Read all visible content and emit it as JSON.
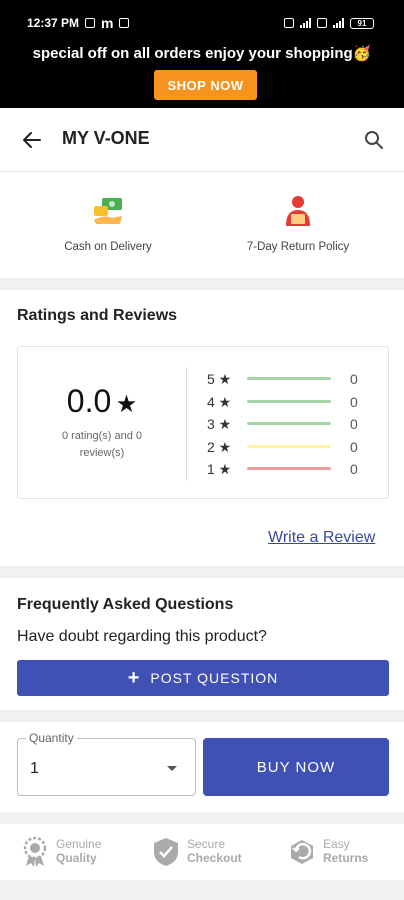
{
  "status_bar": {
    "time": "12:37 PM",
    "battery": "91"
  },
  "promo": {
    "text": "special off on all orders enjoy your shopping🥳",
    "button_label": "SHOP NOW",
    "button_color": "#f7941d"
  },
  "app_bar": {
    "title": "MY V-ONE",
    "back_icon": "arrow-left-icon",
    "search_icon": "search-icon"
  },
  "policies": [
    {
      "label": "Cash on Delivery",
      "icon": "cash-hand-icon"
    },
    {
      "label": "7-Day Return Policy",
      "icon": "return-person-icon"
    }
  ],
  "ratings": {
    "title": "Ratings and Reviews",
    "average": "0.0",
    "star": "★",
    "summary": "0 rating(s) and 0 review(s)",
    "breakdown": [
      {
        "label": "5 ★",
        "count": "0",
        "color": "#a5d6a7"
      },
      {
        "label": "4 ★",
        "count": "0",
        "color": "#a5d6a7"
      },
      {
        "label": "3 ★",
        "count": "0",
        "color": "#a5d6a7"
      },
      {
        "label": "2 ★",
        "count": "0",
        "color": "#fff59d"
      },
      {
        "label": "1 ★",
        "count": "0",
        "color": "#ef9a9a"
      }
    ],
    "write_review": "Write a Review"
  },
  "faq": {
    "title": "Frequently Asked Questions",
    "prompt": "Have doubt regarding this product?",
    "button_label": "POST QUESTION"
  },
  "purchase": {
    "quantity_label": "Quantity",
    "quantity_value": "1",
    "buy_label": "BUY NOW",
    "accent": "#3f51b5"
  },
  "trust_badges": [
    {
      "line1": "Genuine",
      "line2": "Quality",
      "icon": "badge-icon"
    },
    {
      "line1": "Secure",
      "line2": "Checkout",
      "icon": "shield-check-icon"
    },
    {
      "line1": "Easy",
      "line2": "Returns",
      "icon": "return-box-icon"
    }
  ]
}
